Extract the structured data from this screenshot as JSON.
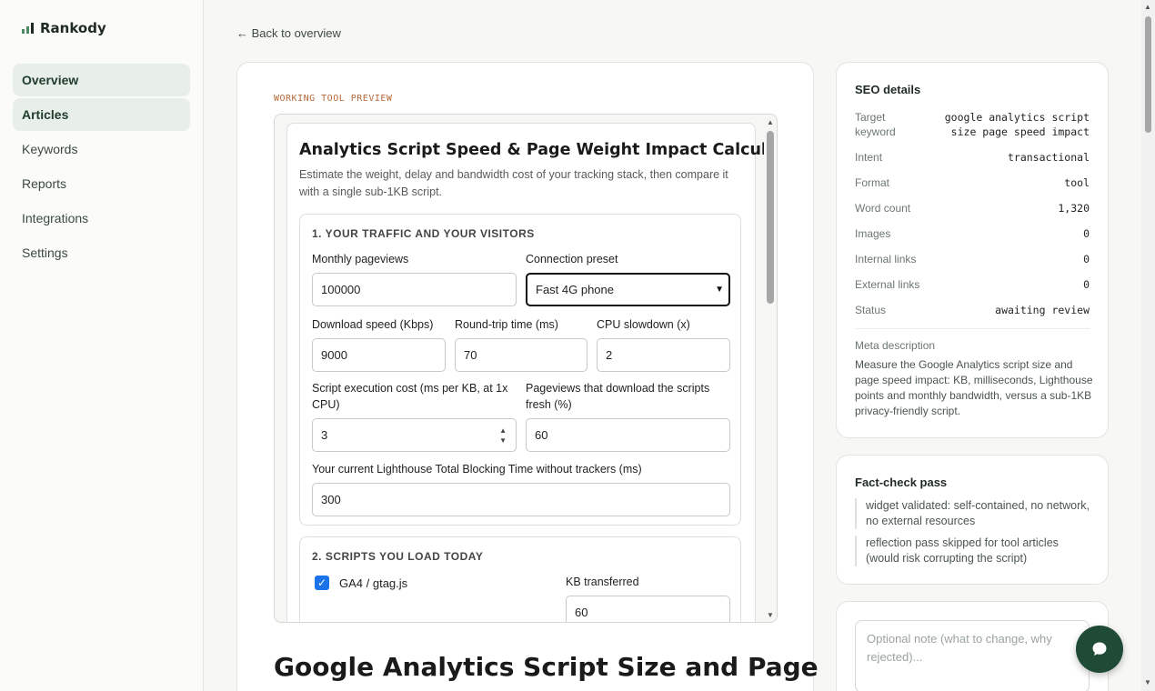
{
  "app": {
    "name": "Rankody"
  },
  "sidebar": {
    "items": [
      {
        "label": "Overview",
        "active": true
      },
      {
        "label": "Articles",
        "active": true
      },
      {
        "label": "Keywords",
        "active": false
      },
      {
        "label": "Reports",
        "active": false
      },
      {
        "label": "Integrations",
        "active": false
      },
      {
        "label": "Settings",
        "active": false
      }
    ]
  },
  "main": {
    "back_link": "← Back to overview",
    "eyebrow": "WORKING TOOL PREVIEW",
    "article_title": "Google Analytics Script Size and Page",
    "tool": {
      "title": "Analytics Script Speed & Page Weight Impact Calculator",
      "description": "Estimate the weight, delay and bandwidth cost of your tracking stack, then compare it with a single sub-1KB script.",
      "section1": {
        "title": "1. YOUR TRAFFIC AND YOUR VISITORS",
        "monthly_pageviews": {
          "label": "Monthly pageviews",
          "value": "100000"
        },
        "connection_preset": {
          "label": "Connection preset",
          "value": "Fast 4G phone"
        },
        "download_speed": {
          "label": "Download speed (Kbps)",
          "value": "9000"
        },
        "rtt": {
          "label": "Round-trip time (ms)",
          "value": "70"
        },
        "cpu_slowdown": {
          "label": "CPU slowdown (x)",
          "value": "2"
        },
        "script_exec": {
          "label": "Script execution cost (ms per KB, at 1x CPU)",
          "value": "3"
        },
        "fresh_pct": {
          "label": "Pageviews that download the scripts fresh (%)",
          "value": "60"
        },
        "tbt": {
          "label": "Your current Lighthouse Total Blocking Time without trackers (ms)",
          "value": "300"
        }
      },
      "section2": {
        "title": "2. SCRIPTS YOU LOAD TODAY",
        "script1": {
          "name": "GA4 / gtag.js",
          "checked": true,
          "kb_label": "KB transferred",
          "kb_value": "60"
        }
      }
    }
  },
  "seo": {
    "title": "SEO details",
    "rows": [
      {
        "key": "Target keyword",
        "value": "google analytics script size page speed impact"
      },
      {
        "key": "Intent",
        "value": "transactional"
      },
      {
        "key": "Format",
        "value": "tool"
      },
      {
        "key": "Word count",
        "value": "1,320"
      },
      {
        "key": "Images",
        "value": "0"
      },
      {
        "key": "Internal links",
        "value": "0"
      },
      {
        "key": "External links",
        "value": "0"
      },
      {
        "key": "Status",
        "value": "awaiting review"
      }
    ],
    "meta_label": "Meta description",
    "meta_text": "Measure the Google Analytics script size and page speed impact: KB, milliseconds, Lighthouse points and monthly bandwidth, versus a sub-1KB privacy-friendly script."
  },
  "factcheck": {
    "title": "Fact-check pass",
    "items": [
      "widget validated: self-contained, no network, no external resources",
      "reflection pass skipped for tool articles (would risk corrupting the script)"
    ]
  },
  "note": {
    "placeholder": "Optional note (what to change, why rejected)..."
  },
  "colors": {
    "accent": "#1f4a36",
    "active_nav": "#e8efe9",
    "eyebrow": "#b4683a",
    "checkbox": "#1a73e8"
  }
}
